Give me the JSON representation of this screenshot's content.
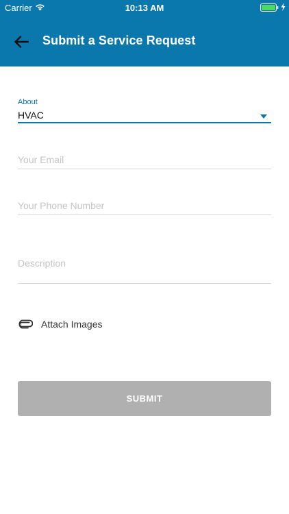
{
  "status_bar": {
    "carrier": "Carrier",
    "time": "10:13 AM",
    "wifi_icon": "wifi-icon",
    "battery_icon": "battery-charging-icon"
  },
  "header": {
    "back_icon": "arrow-left-icon",
    "title": "Submit a Service Request",
    "background_color": "#0a78ad"
  },
  "form": {
    "about": {
      "label": "About",
      "value": "HVAC"
    },
    "email": {
      "placeholder": "Your Email",
      "value": ""
    },
    "phone": {
      "placeholder": "Your Phone Number",
      "value": ""
    },
    "description": {
      "placeholder": "Description",
      "value": ""
    },
    "attach": {
      "icon": "paperclip-icon",
      "label": "Attach Images"
    },
    "submit_label": "SUBMIT",
    "submit_color": "#b0b0b0"
  }
}
